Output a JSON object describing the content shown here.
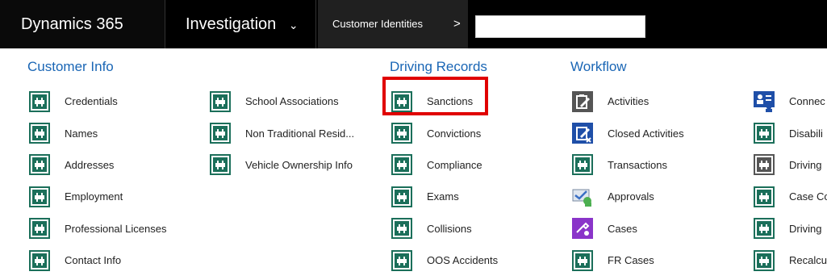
{
  "topbar": {
    "brand": "Dynamics 365",
    "area": "Investigation",
    "breadcrumb": "Customer Identities",
    "breadcrumb_sep": ">",
    "search_value": ""
  },
  "colors": {
    "accent": "#1a66b5",
    "tile_green": "#1b6f5a",
    "tile_gray": "#555555",
    "tile_blue": "#1f4fa8",
    "tile_purple": "#8a34c9",
    "highlight": "#e00000"
  },
  "columns": [
    {
      "header": "Customer Info",
      "items": [
        {
          "label": "Credentials",
          "icon": "entity-icon"
        },
        {
          "label": "Names",
          "icon": "entity-icon"
        },
        {
          "label": "Addresses",
          "icon": "entity-icon"
        },
        {
          "label": "Employment",
          "icon": "entity-icon"
        },
        {
          "label": "Professional Licenses",
          "icon": "entity-icon"
        },
        {
          "label": "Contact Info",
          "icon": "entity-icon"
        }
      ]
    },
    {
      "header": "",
      "items": [
        {
          "label": "School Associations",
          "icon": "entity-icon"
        },
        {
          "label": "Non Traditional Resid...",
          "icon": "entity-icon"
        },
        {
          "label": "Vehicle Ownership Info",
          "icon": "entity-icon"
        }
      ]
    },
    {
      "header": "Driving Records",
      "items": [
        {
          "label": "Sanctions",
          "icon": "entity-icon"
        },
        {
          "label": "Convictions",
          "icon": "entity-icon"
        },
        {
          "label": "Compliance",
          "icon": "entity-icon"
        },
        {
          "label": "Exams",
          "icon": "entity-icon"
        },
        {
          "label": "Collisions",
          "icon": "entity-icon"
        },
        {
          "label": "OOS Accidents",
          "icon": "entity-icon"
        }
      ]
    },
    {
      "header": "Workflow",
      "items": [
        {
          "label": "Activities",
          "icon": "activities-icon"
        },
        {
          "label": "Closed Activities",
          "icon": "closed-activities-icon"
        },
        {
          "label": "Transactions",
          "icon": "entity-icon"
        },
        {
          "label": "Approvals",
          "icon": "approvals-icon"
        },
        {
          "label": "Cases",
          "icon": "cases-icon"
        },
        {
          "label": "FR Cases",
          "icon": "entity-icon"
        }
      ]
    },
    {
      "header": "",
      "items": [
        {
          "label": "Connec",
          "icon": "connections-icon"
        },
        {
          "label": "Disabili",
          "icon": "entity-icon"
        },
        {
          "label": "Driving",
          "icon": "entity-gray-icon"
        },
        {
          "label": "Case Co",
          "icon": "entity-icon"
        },
        {
          "label": "Driving",
          "icon": "entity-icon"
        },
        {
          "label": "Recalcu",
          "icon": "entity-icon"
        }
      ]
    }
  ]
}
